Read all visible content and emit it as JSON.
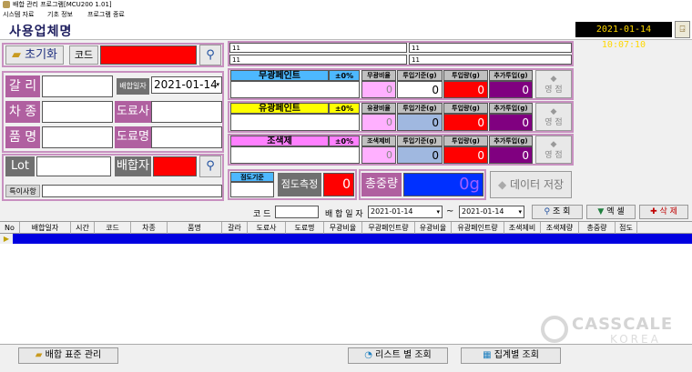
{
  "window": {
    "title": "배합 관리 프로그램[MCU200 1.01]"
  },
  "menu": [
    "시스템 자료",
    "기초 정보",
    "프로그램 종료"
  ],
  "header": {
    "title": "사용업체명",
    "clock": "2021-01-14 10:07:10"
  },
  "left": {
    "reset_button": "초기화",
    "code_label": "코드",
    "gallery_label": "갈 리",
    "mix_date_label": "배합일자",
    "mix_date_value": "2021-01-14",
    "car_type_label": "차 종",
    "painter_label": "도료사",
    "product_label": "품 명",
    "paint_name_label": "도료명",
    "lot_label": "Lot",
    "mixer_label": "배합자",
    "remarks_label": "특이사항"
  },
  "top_fields": [
    "11",
    "11",
    "11",
    "11"
  ],
  "paint_rows": [
    {
      "name": "무광페인트",
      "pct": "±0%",
      "ratio_label": "무광비율",
      "ratio_value": "0",
      "std_label": "투입기준(g)",
      "std_value": "0",
      "input_label": "투입량(g)",
      "input_value": "0",
      "add_label": "추가투입(g)",
      "add_value": "0",
      "zero_label": "영 점",
      "color": "#4db8ff"
    },
    {
      "name": "유광페인트",
      "pct": "±0%",
      "ratio_label": "유광비율",
      "ratio_value": "0",
      "std_label": "투입기준(g)",
      "std_value": "0",
      "input_label": "투입량(g)",
      "input_value": "0",
      "add_label": "추가투입(g)",
      "add_value": "0",
      "zero_label": "영 점",
      "color": "#ffff00"
    },
    {
      "name": "조색제",
      "pct": "±0%",
      "ratio_label": "조색제비",
      "ratio_value": "0",
      "std_label": "투입기준(g)",
      "std_value": "0",
      "input_label": "투입량(g)",
      "input_value": "0",
      "add_label": "추가투입(g)",
      "add_value": "0",
      "zero_label": "영 점",
      "color": "#ff80ff"
    }
  ],
  "viscosity": {
    "std_label": "점도기준",
    "measure_label": "점도측정",
    "measure_value": "0"
  },
  "total": {
    "label": "총중량",
    "value": "0g"
  },
  "save_button": "데이터 저장",
  "search": {
    "code_label": "코 드",
    "date_label": "배 합 일 자",
    "from": "2021-01-14",
    "tilde": "~",
    "to": "2021-01-14",
    "search_btn": "조 회",
    "excel_btn": "엑 셀",
    "delete_btn": "삭 제"
  },
  "grid": {
    "columns": [
      "No",
      "배합일자",
      "시간",
      "코드",
      "차종",
      "품명",
      "갈라",
      "도료사",
      "도료명",
      "무광비율",
      "무광페인트량",
      "유광비율",
      "유광페인트량",
      "조색제비",
      "조색제량",
      "총중량",
      "점도"
    ]
  },
  "bottom": {
    "std_mgmt": "배합 표준 관리",
    "list_query": "리스트 별 조회",
    "summary_query": "집계별 조회"
  },
  "watermark": {
    "line1": "CASSCALE",
    "line2": "KOREA"
  }
}
